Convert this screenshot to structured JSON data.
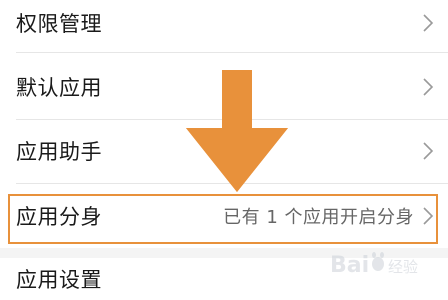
{
  "rows": [
    {
      "label": "权限管理"
    },
    {
      "label": "默认应用"
    },
    {
      "label": "应用助手"
    },
    {
      "label": "应用分身",
      "detail": "已有 1 个应用开启分身"
    },
    {
      "label": "应用设置"
    }
  ],
  "annotation": {
    "arrow_color": "#e8913b",
    "highlight_color": "#e8913b"
  },
  "watermark": {
    "brand": "Baidu",
    "sub": "经验"
  },
  "icons": {
    "chevron": "chevron-right-icon",
    "arrow": "down-arrow-annotation-icon"
  }
}
